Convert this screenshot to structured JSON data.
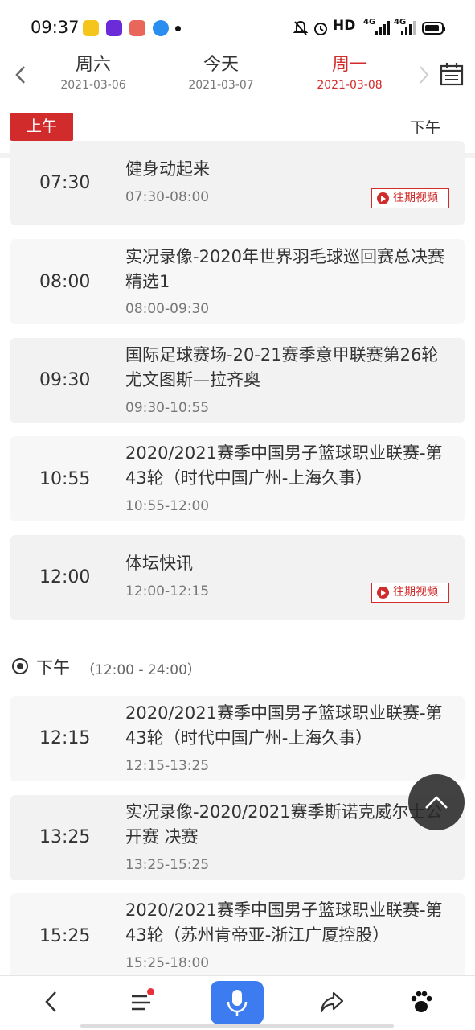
{
  "statusbar": {
    "time": "09:37",
    "network": "HD",
    "signal1": "4G",
    "signal2": "4G"
  },
  "header": {
    "days": [
      {
        "name": "周六",
        "date": "2021-03-06"
      },
      {
        "name": "今天",
        "date": "2021-03-07"
      },
      {
        "name": "周一",
        "date": "2021-03-08"
      }
    ],
    "active_index": 2
  },
  "period_tabs": {
    "am": "上午",
    "pm": "下午"
  },
  "programs": [
    {
      "time": "07:30",
      "title": "健身动起来",
      "range": "07:30-08:00",
      "replay": "往期视频"
    },
    {
      "time": "08:00",
      "title": "实况录像-2020年世界羽毛球巡回赛总决赛 精选1",
      "range": "08:00-09:30"
    },
    {
      "time": "09:30",
      "title": "国际足球赛场-20-21赛季意甲联赛第26轮 尤文图斯—拉齐奥",
      "range": "09:30-10:55"
    },
    {
      "time": "10:55",
      "title": "2020/2021赛季中国男子篮球职业联赛-第43轮（时代中国广州-上海久事）",
      "range": "10:55-12:00"
    },
    {
      "time": "12:00",
      "title": "体坛快讯",
      "range": "12:00-12:15",
      "replay": "往期视频"
    }
  ],
  "pm_section": {
    "label": "下午",
    "range": "（12:00 - 24:00）"
  },
  "pm_programs": [
    {
      "time": "12:15",
      "title": "2020/2021赛季中国男子篮球职业联赛-第43轮（时代中国广州-上海久事）",
      "range": "12:15-13:25"
    },
    {
      "time": "13:25",
      "title": "实况录像-2020/2021赛季斯诺克威尔士公开赛 决赛",
      "range": "13:25-15:25"
    },
    {
      "time": "15:25",
      "title": "2020/2021赛季中国男子篮球职业联赛-第43轮（苏州肯帝亚-浙江广厦控股）",
      "range": "15:25-18:00"
    }
  ],
  "colors": {
    "accent": "#d22b2b",
    "mic": "#3d7cf0"
  }
}
